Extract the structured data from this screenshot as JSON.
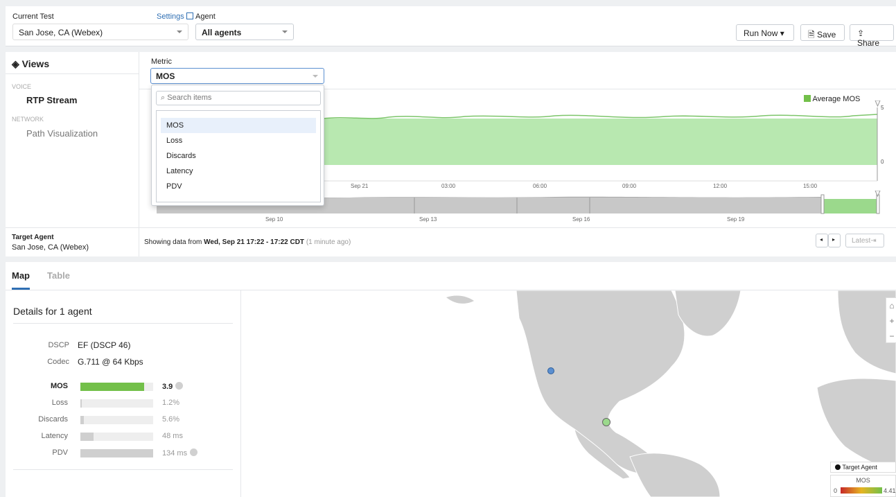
{
  "header": {
    "current_test_label": "Current Test",
    "current_test_value": "San Jose, CA (Webex)",
    "settings_link": "Settings",
    "agent_label": "Agent",
    "agent_value": "All agents",
    "run_now": "Run Now",
    "save": "Save",
    "share": "Share"
  },
  "views": {
    "title": "Views",
    "groups": [
      {
        "heading": "VOICE",
        "item": "RTP Stream"
      },
      {
        "heading": "NETWORK",
        "item": "Path Visualization"
      }
    ],
    "target_agent_label": "Target Agent",
    "target_agent_value": "San Jose, CA (Webex)"
  },
  "metric": {
    "label": "Metric",
    "value": "MOS",
    "search_placeholder": "Search items",
    "options": [
      "MOS",
      "Loss",
      "Discards",
      "Latency",
      "PDV"
    ]
  },
  "chart": {
    "legend": "Average MOS",
    "y_max_label": "5",
    "y_min_label": "0",
    "x_ticks": [
      "Sep 21",
      "03:00",
      "06:00",
      "09:00",
      "12:00",
      "15:00"
    ],
    "timeline_ticks": [
      "Sep 10",
      "Sep 13",
      "Sep 16",
      "Sep 19"
    ]
  },
  "status": {
    "prefix": "Showing data from ",
    "range": "Wed, Sep 21 17:22 - 17:22 CDT",
    "suffix": " (1 minute ago)",
    "latest": "Latest⇥"
  },
  "tabs": [
    "Map",
    "Table"
  ],
  "details": {
    "title": "Details for 1 agent",
    "dscp_label": "DSCP",
    "dscp_value": "EF (DSCP 46)",
    "codec_label": "Codec",
    "codec_value": "G.711 @ 64 Kbps",
    "metrics": [
      {
        "label": "MOS",
        "value": "3.9",
        "fill": 0.88
      },
      {
        "label": "Loss",
        "value": "1.2%",
        "fill": 0.02
      },
      {
        "label": "Discards",
        "value": "5.6%",
        "fill": 0.05
      },
      {
        "label": "Latency",
        "value": "48 ms",
        "fill": 0.18
      },
      {
        "label": "PDV",
        "value": "134 ms",
        "fill": 1.0
      }
    ]
  },
  "map_legend": {
    "target_agent": "Target Agent",
    "scale_title": "MOS",
    "scale_min": "0",
    "scale_max": "4.41"
  },
  "colors": {
    "accent": "#2f6fb3",
    "mos_green": "#73c04a",
    "chart_fill": "#b8e8b0"
  }
}
